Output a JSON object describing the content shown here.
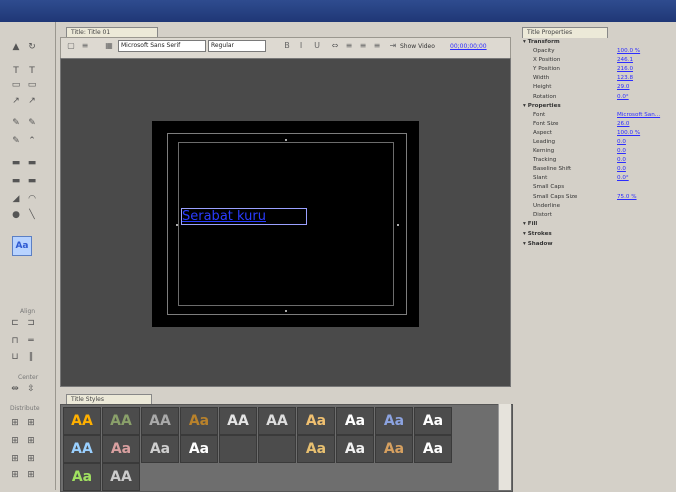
{
  "doc_tab": {
    "title": "Title: Title 01"
  },
  "toolbar": {
    "font_value": "Microsoft Sans Serif",
    "style_value": "Regular",
    "show_video_label": "Show Video",
    "timecode": "00;00;00;00"
  },
  "canvas": {
    "text": "Serabat kuru"
  },
  "left_tools": {
    "align_label": "Align",
    "center_label": "Center",
    "distribute_label": "Distribute"
  },
  "styles": {
    "tab_title": "Title Styles",
    "swatches": [
      "AA",
      "AA",
      "AA",
      "Aa",
      "AA",
      "AA",
      "Aa",
      "Aa",
      "Aa",
      "Aa",
      "AA",
      "Aa",
      "Aa",
      "Aa",
      "",
      "",
      "Aa",
      "Aa",
      "Aa",
      "Aa",
      "Aa",
      "AA"
    ],
    "swatch_colors": [
      "#ffb000",
      "#8aa06a",
      "#aaaaaa",
      "#b9822b",
      "#e5e5e5",
      "#dedede",
      "#f0c070",
      "#ffffff",
      "#8ca3e0",
      "#ffffff",
      "#9ad0ff",
      "#d9a0a0",
      "#cfcfcf",
      "#ffffff",
      "#7fd6ff",
      "#4c4c4c",
      "#e8c070",
      "#f2f2f2",
      "#d6a060",
      "#ffffff",
      "#a0e060",
      "#cccccc"
    ]
  },
  "properties": {
    "tab_title": "Title Properties",
    "sections": [
      {
        "type": "section",
        "label": "Transform"
      },
      {
        "type": "row",
        "key": "Opacity",
        "value": "100.0 %"
      },
      {
        "type": "row",
        "key": "X Position",
        "value": "246.1"
      },
      {
        "type": "row",
        "key": "Y Position",
        "value": "216.0"
      },
      {
        "type": "row",
        "key": "Width",
        "value": "123.8"
      },
      {
        "type": "row",
        "key": "Height",
        "value": "29.0"
      },
      {
        "type": "row",
        "key": "Rotation",
        "value": "0.0°"
      },
      {
        "type": "section",
        "label": "Properties"
      },
      {
        "type": "row",
        "key": "Font",
        "value": "Microsoft San..."
      },
      {
        "type": "row",
        "key": "Font Size",
        "value": "26.0"
      },
      {
        "type": "row",
        "key": "Aspect",
        "value": "100.0 %"
      },
      {
        "type": "row",
        "key": "Leading",
        "value": "0.0"
      },
      {
        "type": "row",
        "key": "Kerning",
        "value": "0.0"
      },
      {
        "type": "row",
        "key": "Tracking",
        "value": "0.0"
      },
      {
        "type": "row",
        "key": "Baseline Shift",
        "value": "0.0"
      },
      {
        "type": "row",
        "key": "Slant",
        "value": "0.0°"
      },
      {
        "type": "row",
        "key": "Small Caps",
        "value": ""
      },
      {
        "type": "row",
        "key": "Small Caps Size",
        "value": "75.0 %"
      },
      {
        "type": "row",
        "key": "Underline",
        "value": ""
      },
      {
        "type": "row",
        "key": "Distort",
        "value": ""
      },
      {
        "type": "section",
        "label": "Fill"
      },
      {
        "type": "section",
        "label": "Strokes"
      },
      {
        "type": "section",
        "label": "Shadow"
      }
    ]
  }
}
